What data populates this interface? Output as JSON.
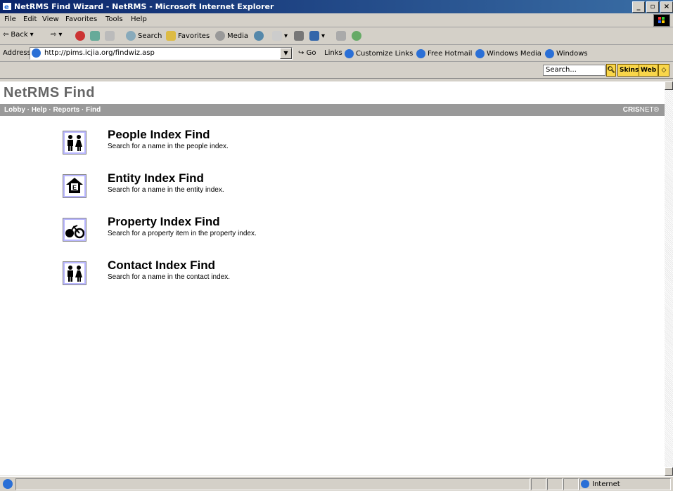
{
  "window": {
    "title": "NetRMS Find Wizard - NetRMS - Microsoft Internet Explorer",
    "controls": [
      "_",
      "̅□",
      "x"
    ]
  },
  "menu": [
    "File",
    "Edit",
    "View",
    "Favorites",
    "Tools",
    "Help"
  ],
  "toolbar": {
    "back": "Back",
    "search": "Search",
    "favorites": "Favorites",
    "media": "Media"
  },
  "address": {
    "label": "Address",
    "url": "http://pims.icjia.org/findwiz.asp",
    "go": "Go",
    "links_label": "Links",
    "links": [
      "Customize Links",
      "Free Hotmail",
      "Windows Media",
      "Windows"
    ]
  },
  "searchbar": {
    "placeholder": "Search...",
    "skins": "Skins",
    "web": "Web"
  },
  "page": {
    "title": "NetRMS Find",
    "nav": "Lobby · Help · Reports · Find",
    "brand_bold": "CRIS",
    "brand_rest": "NET®",
    "items": [
      {
        "title": "People Index Find",
        "desc": "Search for a name in the people index.",
        "icon": "people-icon"
      },
      {
        "title": "Entity Index Find",
        "desc": "Search for a name in the entity index.",
        "icon": "entity-icon"
      },
      {
        "title": "Property Index Find",
        "desc": "Search for a property item in the property index.",
        "icon": "bicycle-icon"
      },
      {
        "title": "Contact Index Find",
        "desc": "Search for a name in the contact index.",
        "icon": "contact-icon"
      }
    ]
  },
  "status": {
    "zone": "Internet"
  }
}
